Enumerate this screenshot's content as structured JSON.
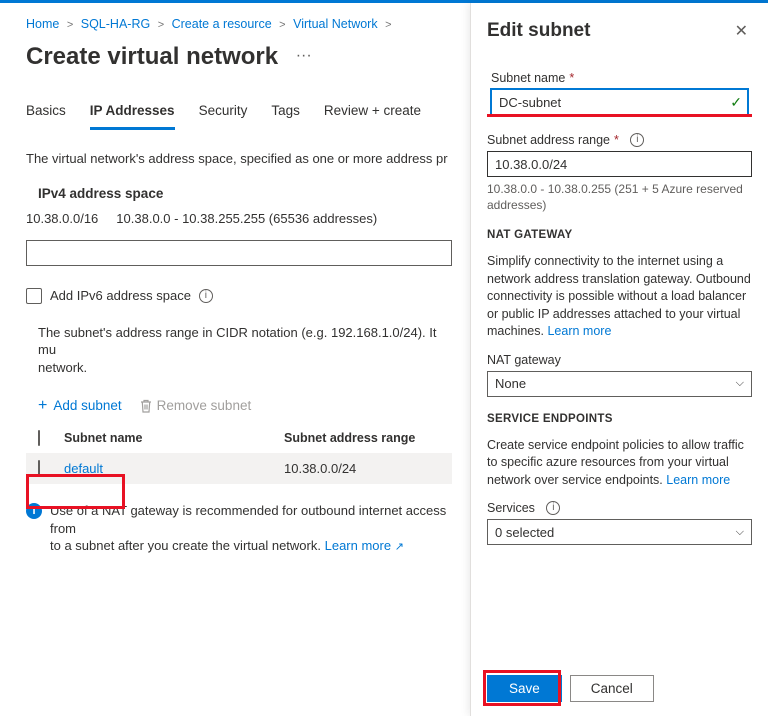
{
  "breadcrumb": {
    "home": "Home",
    "rg": "SQL-HA-RG",
    "create": "Create a resource",
    "vnet": "Virtual Network"
  },
  "page_title": "Create virtual network",
  "tabs": {
    "basics": "Basics",
    "ip": "IP Addresses",
    "security": "Security",
    "tags": "Tags",
    "review": "Review + create"
  },
  "main": {
    "desc": "The virtual network's address space, specified as one or more address pr",
    "ipv4_label": "IPv4 address space",
    "addr_cidr": "10.38.0.0/16",
    "addr_range": "10.38.0.0 - 10.38.255.255 (65536 addresses)",
    "ipv6_check": "Add IPv6 address space",
    "subnet_desc": "The subnet's address range in CIDR notation (e.g. 192.168.1.0/24). It mu",
    "subnet_desc2": "network.",
    "add_subnet": "Add subnet",
    "remove_subnet": "Remove subnet",
    "col_name": "Subnet name",
    "col_range": "Subnet address range",
    "row": {
      "name": "default",
      "range": "10.38.0.0/24"
    },
    "nat_banner": "Use of a NAT gateway is recommended for outbound internet access from",
    "nat_banner2": "to a subnet after you create the virtual network.",
    "learn_more": "Learn more"
  },
  "panel": {
    "title": "Edit subnet",
    "name_label": "Subnet name",
    "name_value": "DC-subnet",
    "range_label": "Subnet address range",
    "range_value": "10.38.0.0/24",
    "range_hint": "10.38.0.0 - 10.38.0.255 (251 + 5 Azure reserved addresses)",
    "nat_caption": "NAT GATEWAY",
    "nat_text": "Simplify connectivity to the internet using a network address translation gateway. Outbound connectivity is possible without a load balancer or public IP addresses attached to your virtual machines.",
    "nat_select_label": "NAT gateway",
    "nat_select_value": "None",
    "se_caption": "SERVICE ENDPOINTS",
    "se_text": "Create service endpoint policies to allow traffic to specific azure resources from your virtual network over service endpoints.",
    "services_label": "Services",
    "services_value": "0 selected",
    "learn_more": "Learn more",
    "save": "Save",
    "cancel": "Cancel"
  }
}
